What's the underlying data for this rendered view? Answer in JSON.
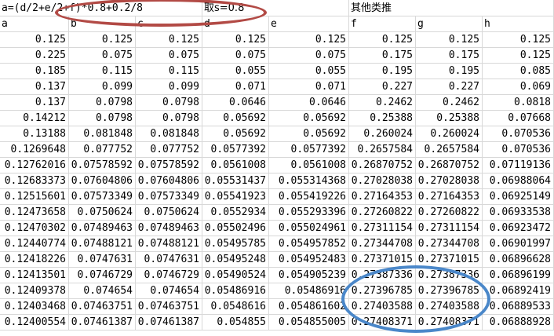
{
  "header": {
    "formula": "a=(d/2+e/2+f)*0.8+0.2/8",
    "s_note": "取s=0.8",
    "others_note": "其他类推"
  },
  "columns": [
    "a",
    "b",
    "c",
    "d",
    "e",
    "f",
    "g",
    "h"
  ],
  "rows": [
    [
      "0.125",
      "0.125",
      "0.125",
      "0.125",
      "0.125",
      "0.125",
      "0.125",
      "0.125"
    ],
    [
      "0.225",
      "0.075",
      "0.075",
      "0.075",
      "0.075",
      "0.175",
      "0.175",
      "0.125"
    ],
    [
      "0.185",
      "0.115",
      "0.115",
      "0.055",
      "0.055",
      "0.195",
      "0.195",
      "0.085"
    ],
    [
      "0.137",
      "0.099",
      "0.099",
      "0.071",
      "0.071",
      "0.227",
      "0.227",
      "0.069"
    ],
    [
      "0.137",
      "0.0798",
      "0.0798",
      "0.0646",
      "0.0646",
      "0.2462",
      "0.2462",
      "0.0818"
    ],
    [
      "0.14212",
      "0.0798",
      "0.0798",
      "0.05692",
      "0.05692",
      "0.25388",
      "0.25388",
      "0.07668"
    ],
    [
      "0.13188",
      "0.081848",
      "0.081848",
      "0.05692",
      "0.05692",
      "0.260024",
      "0.260024",
      "0.070536"
    ],
    [
      "0.1269648",
      "0.077752",
      "0.077752",
      "0.0577392",
      "0.0577392",
      "0.2657584",
      "0.2657584",
      "0.070536"
    ],
    [
      "0.12762016",
      "0.07578592",
      "0.07578592",
      "0.0561008",
      "0.0561008",
      "0.26870752",
      "0.26870752",
      "0.07119136"
    ],
    [
      "0.12683373",
      "0.07604806",
      "0.07604806",
      "0.05531437",
      "0.055314368",
      "0.27028038",
      "0.27028038",
      "0.06988064"
    ],
    [
      "0.12515601",
      "0.07573349",
      "0.07573349",
      "0.05541923",
      "0.055419226",
      "0.27164353",
      "0.27164353",
      "0.06925149"
    ],
    [
      "0.12473658",
      "0.0750624",
      "0.0750624",
      "0.0552934",
      "0.055293396",
      "0.27260822",
      "0.27260822",
      "0.06933538"
    ],
    [
      "0.12470302",
      "0.07489463",
      "0.07489463",
      "0.05502496",
      "0.055024961",
      "0.27311154",
      "0.27311154",
      "0.06923472"
    ],
    [
      "0.12440774",
      "0.07488121",
      "0.07488121",
      "0.05495785",
      "0.054957852",
      "0.27344708",
      "0.27344708",
      "0.06901997"
    ],
    [
      "0.12418226",
      "0.0747631",
      "0.0747631",
      "0.05495248",
      "0.054952483",
      "0.27371015",
      "0.27371015",
      "0.06896628"
    ],
    [
      "0.12413501",
      "0.0746729",
      "0.0746729",
      "0.05490524",
      "0.054905239",
      "0.27387336",
      "0.27387336",
      "0.06896199"
    ],
    [
      "0.12409378",
      "0.074654",
      "0.074654",
      "0.05486916",
      "0.05486916",
      "0.27396785",
      "0.27396785",
      "0.06892419"
    ],
    [
      "0.12403468",
      "0.07463751",
      "0.07463751",
      "0.0548616",
      "0.054861602",
      "0.27403588",
      "0.27403588",
      "0.06889533"
    ],
    [
      "0.12400554",
      "0.07461387",
      "0.07461387",
      "0.054855",
      "0.054855005",
      "0.27408371",
      "0.27408371",
      "0.06888928"
    ]
  ],
  "annotations": {
    "red_circle_color": "#b24a45",
    "blue_circle_color": "#4a87c9"
  }
}
